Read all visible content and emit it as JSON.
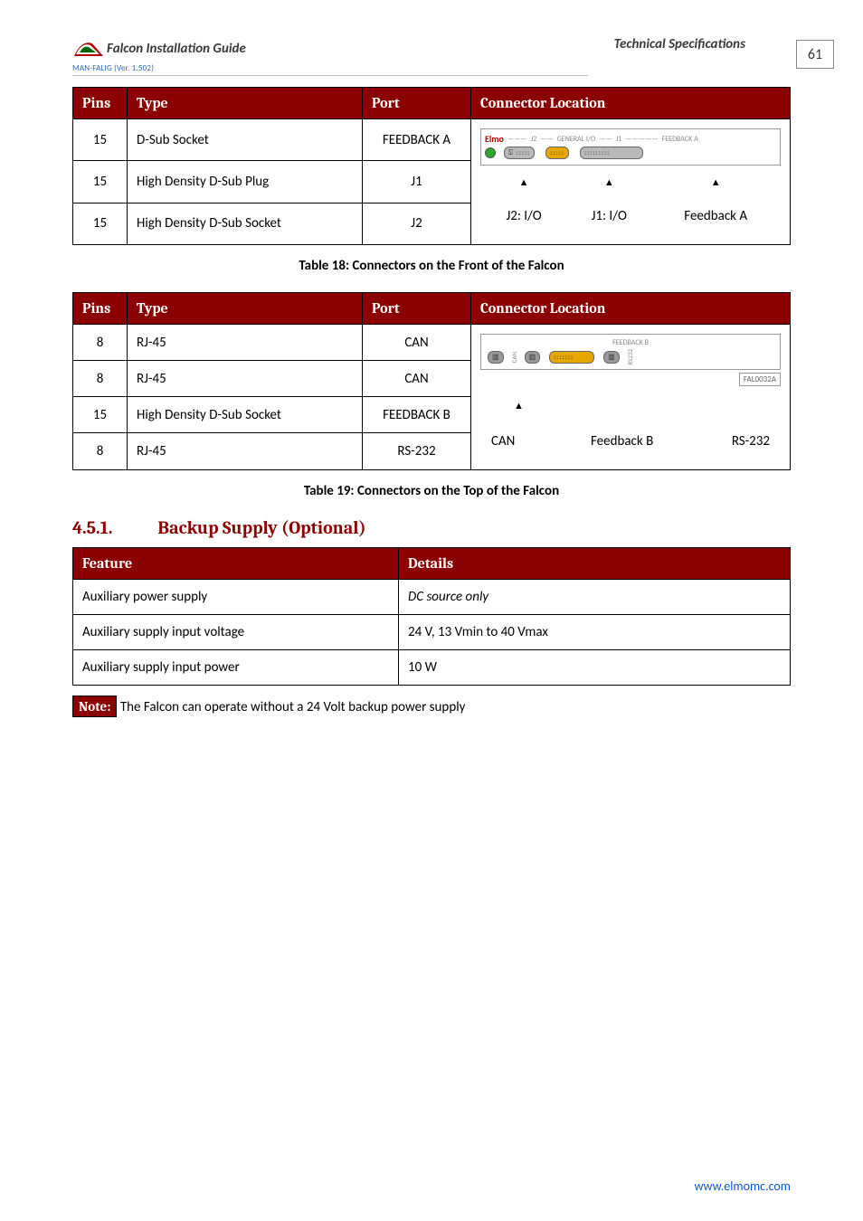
{
  "header": {
    "doc_title": "Falcon Installation Guide",
    "spec_title": "Technical Specifications",
    "version_line": "MAN-FALIG (Ver. 1.502)",
    "page_number": "61"
  },
  "table_a": {
    "headers": [
      "Pins",
      "Type",
      "Port",
      "Connector Location"
    ],
    "rows": [
      {
        "pins": "15",
        "type": "D-Sub Socket",
        "port": "FEEDBACK A"
      },
      {
        "pins": "15",
        "type": "High Density D-Sub Plug",
        "port": "J1"
      },
      {
        "pins": "15",
        "type": "High Density D-Sub Socket",
        "port": "J2"
      }
    ],
    "diagram": {
      "strip_label_left": "J2",
      "strip_label_mid": "GENERAL I/O",
      "strip_label_right": "J1",
      "strip_label_far_right": "FEEDBACK A",
      "below_left": "J2: I/O",
      "below_mid": "J1: I/O",
      "below_right": "Feedback A",
      "brand": "Elmo"
    },
    "caption": "Table 18: Connectors on the Front of the Falcon"
  },
  "table_b": {
    "headers": [
      "Pins",
      "Type",
      "Port",
      "Connector Location"
    ],
    "rows": [
      {
        "pins": "8",
        "type": "RJ-45",
        "port": "CAN"
      },
      {
        "pins": "8",
        "type": "RJ-45",
        "port": "CAN"
      },
      {
        "pins": "15",
        "type": "High Density D-Sub Socket",
        "port": "FEEDBACK B"
      },
      {
        "pins": "8",
        "type": "RJ-45",
        "port": "RS-232"
      }
    ],
    "diagram": {
      "strip_label_top": "FEEDBACK B",
      "label_can_vert": "CAN",
      "label_rs232_vert": "RS232",
      "fal_code": "FAL0032A",
      "below_left": "CAN",
      "below_mid": "Feedback B",
      "below_right": "RS-232"
    },
    "caption": "Table 19: Connectors on the Top of the Falcon"
  },
  "section": {
    "number": "4.5.1.",
    "title": "Backup Supply (Optional)"
  },
  "feature_table": {
    "headers": [
      "Feature",
      "Details"
    ],
    "rows": [
      {
        "feature": "Auxiliary power supply",
        "details": "DC source only",
        "italic": true
      },
      {
        "feature": "Auxiliary supply input voltage",
        "details": "24 V, 13 Vmin to 40 Vmax",
        "italic": false
      },
      {
        "feature": "Auxiliary supply input power",
        "details": "10 W",
        "italic": false
      }
    ]
  },
  "note": {
    "tag": "Note:",
    "text": " The Falcon can operate without a 24 Volt backup power supply"
  },
  "footer_url": "www.elmomc.com"
}
